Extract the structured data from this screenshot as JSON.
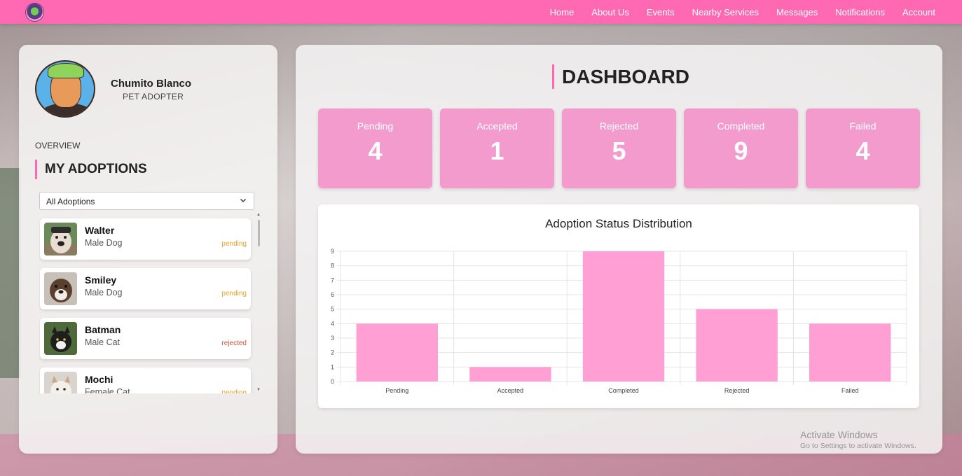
{
  "nav": {
    "links": [
      "Home",
      "About Us",
      "Events",
      "Nearby Services",
      "Messages",
      "Notifications",
      "Account"
    ]
  },
  "profile": {
    "name": "Chumito Blanco",
    "role": "PET ADOPTER"
  },
  "sidebar": {
    "overview_label": "OVERVIEW",
    "section_title": "MY ADOPTIONS",
    "filter_value": "All Adoptions",
    "adoptions": [
      {
        "name": "Walter",
        "type": "Male Dog",
        "status": "pending"
      },
      {
        "name": "Smiley",
        "type": "Male Dog",
        "status": "pending"
      },
      {
        "name": "Batman",
        "type": "Male Cat",
        "status": "rejected"
      },
      {
        "name": "Mochi",
        "type": "Female Cat",
        "status": "pending"
      }
    ]
  },
  "dashboard": {
    "title": "DASHBOARD",
    "stats": [
      {
        "label": "Pending",
        "value": "4"
      },
      {
        "label": "Accepted",
        "value": "1"
      },
      {
        "label": "Rejected",
        "value": "5"
      },
      {
        "label": "Completed",
        "value": "9"
      },
      {
        "label": "Failed",
        "value": "4"
      }
    ]
  },
  "colors": {
    "accent": "#ff69b4",
    "stat_card": "#f39bcc",
    "bar": "#ff9fd4",
    "pending": "#f0a020",
    "rejected": "#e0503c"
  },
  "chart_data": {
    "type": "bar",
    "title": "Adoption Status Distribution",
    "categories": [
      "Pending",
      "Accepted",
      "Completed",
      "Rejected",
      "Failed"
    ],
    "values": [
      4,
      1,
      9,
      5,
      4
    ],
    "ylim": [
      0,
      9
    ],
    "yticks": [
      0,
      1,
      2,
      3,
      4,
      5,
      6,
      7,
      8,
      9
    ],
    "grid": true,
    "legend": "none"
  },
  "watermark": {
    "line1": "Activate Windows",
    "line2": "Go to Settings to activate Windows."
  }
}
